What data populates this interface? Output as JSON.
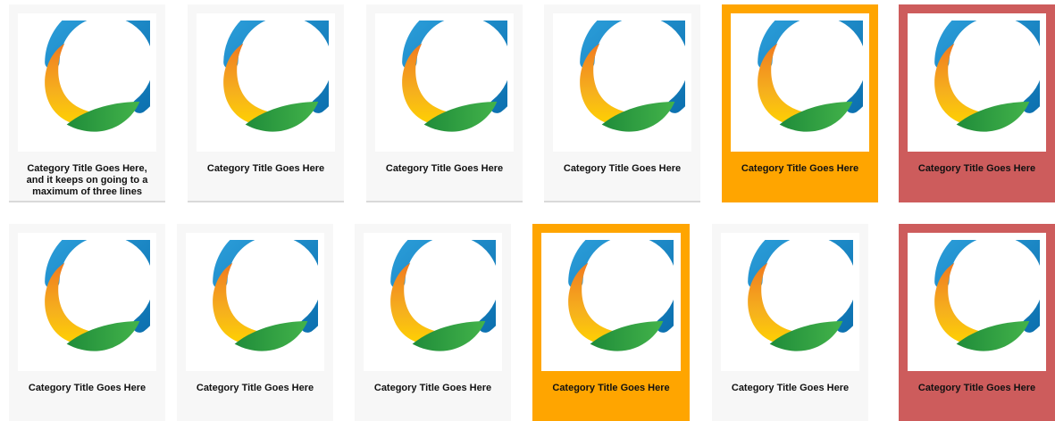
{
  "grid": {
    "row1": [
      {
        "title": "Category Title Goes Here, and it keeps on going to a maximum of three lines",
        "state": "default",
        "logo": "circular-swoosh-logo"
      },
      {
        "title": "Category Title Goes Here",
        "state": "default",
        "logo": "circular-swoosh-logo"
      },
      {
        "title": "Category Title Goes Here",
        "state": "default",
        "logo": "circular-swoosh-logo"
      },
      {
        "title": "Category Title Goes Here",
        "state": "default",
        "logo": "circular-swoosh-logo"
      },
      {
        "title": "Category Title Goes Here",
        "state": "hover",
        "logo": "circular-swoosh-logo"
      },
      {
        "title": "Category Title Goes Here",
        "state": "active",
        "logo": "circular-swoosh-logo"
      }
    ],
    "row2": [
      {
        "title": "Category Title Goes Here",
        "state": "default",
        "logo": "circular-swoosh-logo"
      },
      {
        "title": "Category Title Goes Here",
        "state": "default",
        "logo": "circular-swoosh-logo"
      },
      {
        "title": "Category Title Goes Here",
        "state": "default",
        "logo": "circular-swoosh-logo"
      },
      {
        "title": "Category Title Goes Here",
        "state": "hover",
        "logo": "circular-swoosh-logo"
      },
      {
        "title": "Category Title Goes Here",
        "state": "default",
        "logo": "circular-swoosh-logo"
      },
      {
        "title": "Category Title Goes Here",
        "state": "active",
        "logo": "circular-swoosh-logo"
      }
    ]
  },
  "colors": {
    "card_bg": "#f7f7f7",
    "hover": "#ffa500",
    "active": "#cd5c5c",
    "logo_blue": "#1a8fd0",
    "logo_orange": "#f39c12",
    "logo_yellow": "#ffd000",
    "logo_green": "#2e9e47"
  }
}
